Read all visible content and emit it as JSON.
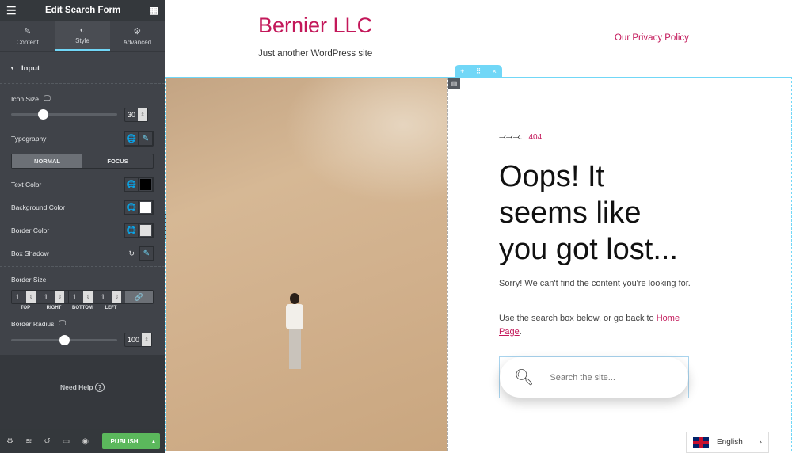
{
  "panel": {
    "title": "Edit Search Form",
    "tabs": [
      {
        "label": "Content",
        "icon": "pencil-icon"
      },
      {
        "label": "Style",
        "icon": "contrast-icon"
      },
      {
        "label": "Advanced",
        "icon": "gear-icon"
      }
    ],
    "section": "Input",
    "icon_size_label": "Icon Size",
    "icon_size": "30",
    "icon_size_fraction": 0.3,
    "typography_label": "Typography",
    "normal": "NORMAL",
    "focus": "FOCUS",
    "text_color_label": "Text Color",
    "text_color": "#000000",
    "bg_color_label": "Background Color",
    "bg_color": "#ffffff",
    "border_color_label": "Border Color",
    "border_color": "#e0e0e0",
    "box_shadow_label": "Box Shadow",
    "border_size_label": "Border Size",
    "border_sizes": [
      {
        "value": "1",
        "label": "TOP"
      },
      {
        "value": "1",
        "label": "RIGHT"
      },
      {
        "value": "1",
        "label": "BOTTOM"
      },
      {
        "value": "1",
        "label": "LEFT"
      }
    ],
    "border_radius_label": "Border Radius",
    "border_radius": "100",
    "border_radius_fraction": 0.5,
    "need_help": "Need Help",
    "publish": "PUBLISH"
  },
  "site": {
    "title": "Bernier LLC",
    "tagline": "Just another WordPress site",
    "nav_link": "Our Privacy Policy",
    "code": "404",
    "heading": "Oops! It seems like you got lost...",
    "p1": "Sorry! We can't find the content you're looking for.",
    "p2": "Use the search box below, or go back to ",
    "home_link": "Home Page",
    "p2_end": ".",
    "search_placeholder": "Search the site...",
    "language": "English"
  },
  "colors": {
    "accent": "#c3185a",
    "editor_blue": "#71d7f7",
    "publish": "#5bb85c"
  }
}
